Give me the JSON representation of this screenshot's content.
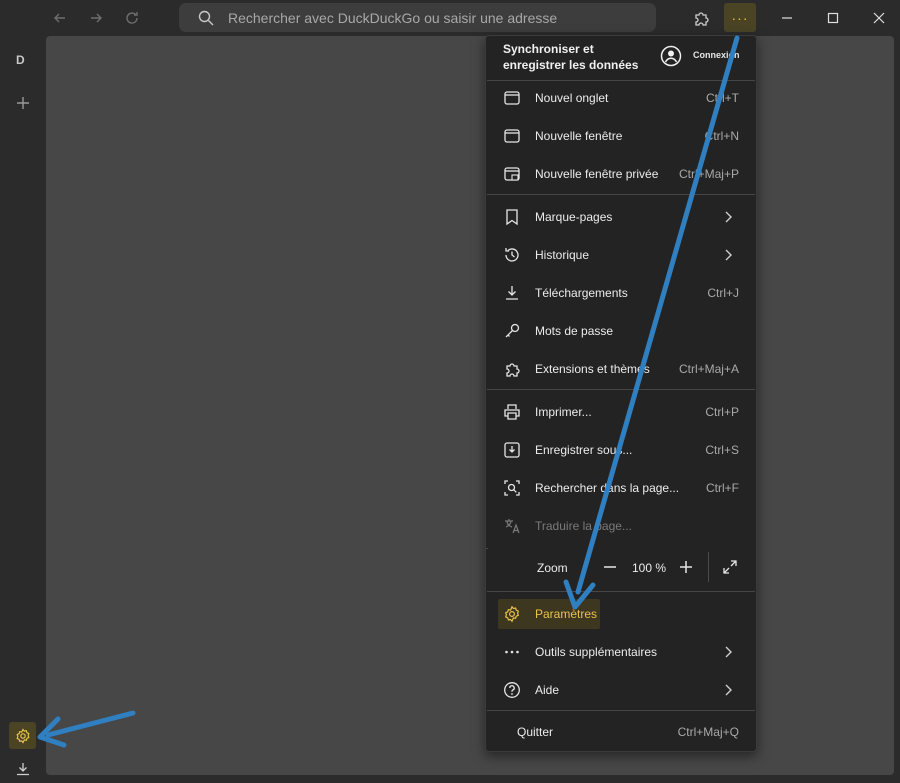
{
  "toolbar": {
    "url_placeholder": "Rechercher avec DuckDuckGo ou saisir une adresse",
    "menu_glyph": "···"
  },
  "sidebar": {
    "profile_letter": "D"
  },
  "menu": {
    "sync_title": "Synchroniser et enregistrer les données",
    "account_label": "Connexion",
    "items": [
      {
        "label": "Nouvel onglet",
        "shortcut": "Ctrl+T",
        "icon": "new-tab-icon"
      },
      {
        "label": "Nouvelle fenêtre",
        "shortcut": "Ctrl+N",
        "icon": "new-window-icon"
      },
      {
        "label": "Nouvelle fenêtre privée",
        "shortcut": "Ctrl+Maj+P",
        "icon": "private-window-icon"
      },
      {
        "label": "Marque-pages",
        "shortcut": "",
        "icon": "bookmark-icon"
      },
      {
        "label": "Historique",
        "shortcut": "",
        "icon": "history-icon"
      },
      {
        "label": "Téléchargements",
        "shortcut": "Ctrl+J",
        "icon": "download-icon"
      },
      {
        "label": "Mots de passe",
        "shortcut": "",
        "icon": "key-icon"
      },
      {
        "label": "Extensions et thèmes",
        "shortcut": "Ctrl+Maj+A",
        "icon": "puzzle-icon"
      },
      {
        "label": "Imprimer...",
        "shortcut": "Ctrl+P",
        "icon": "printer-icon"
      },
      {
        "label": "Enregistrer sous...",
        "shortcut": "Ctrl+S",
        "icon": "save-icon"
      },
      {
        "label": "Rechercher dans la page...",
        "shortcut": "Ctrl+F",
        "icon": "find-icon"
      },
      {
        "label": "Traduire la page...",
        "shortcut": "",
        "icon": "translate-icon"
      },
      {
        "label": "Paramètres",
        "shortcut": "",
        "icon": "gear-icon"
      },
      {
        "label": "Outils supplémentaires",
        "shortcut": "",
        "icon": "more-tools-icon"
      },
      {
        "label": "Aide",
        "shortcut": "",
        "icon": "help-icon"
      },
      {
        "label": "Quitter",
        "shortcut": "Ctrl+Maj+Q",
        "icon": ""
      }
    ],
    "zoom": {
      "label": "Zoom",
      "value": "100 %"
    }
  },
  "colors": {
    "accent": "#e7c34a",
    "annotation_arrow": "#2f7fc1",
    "menu_bg": "#232323"
  }
}
